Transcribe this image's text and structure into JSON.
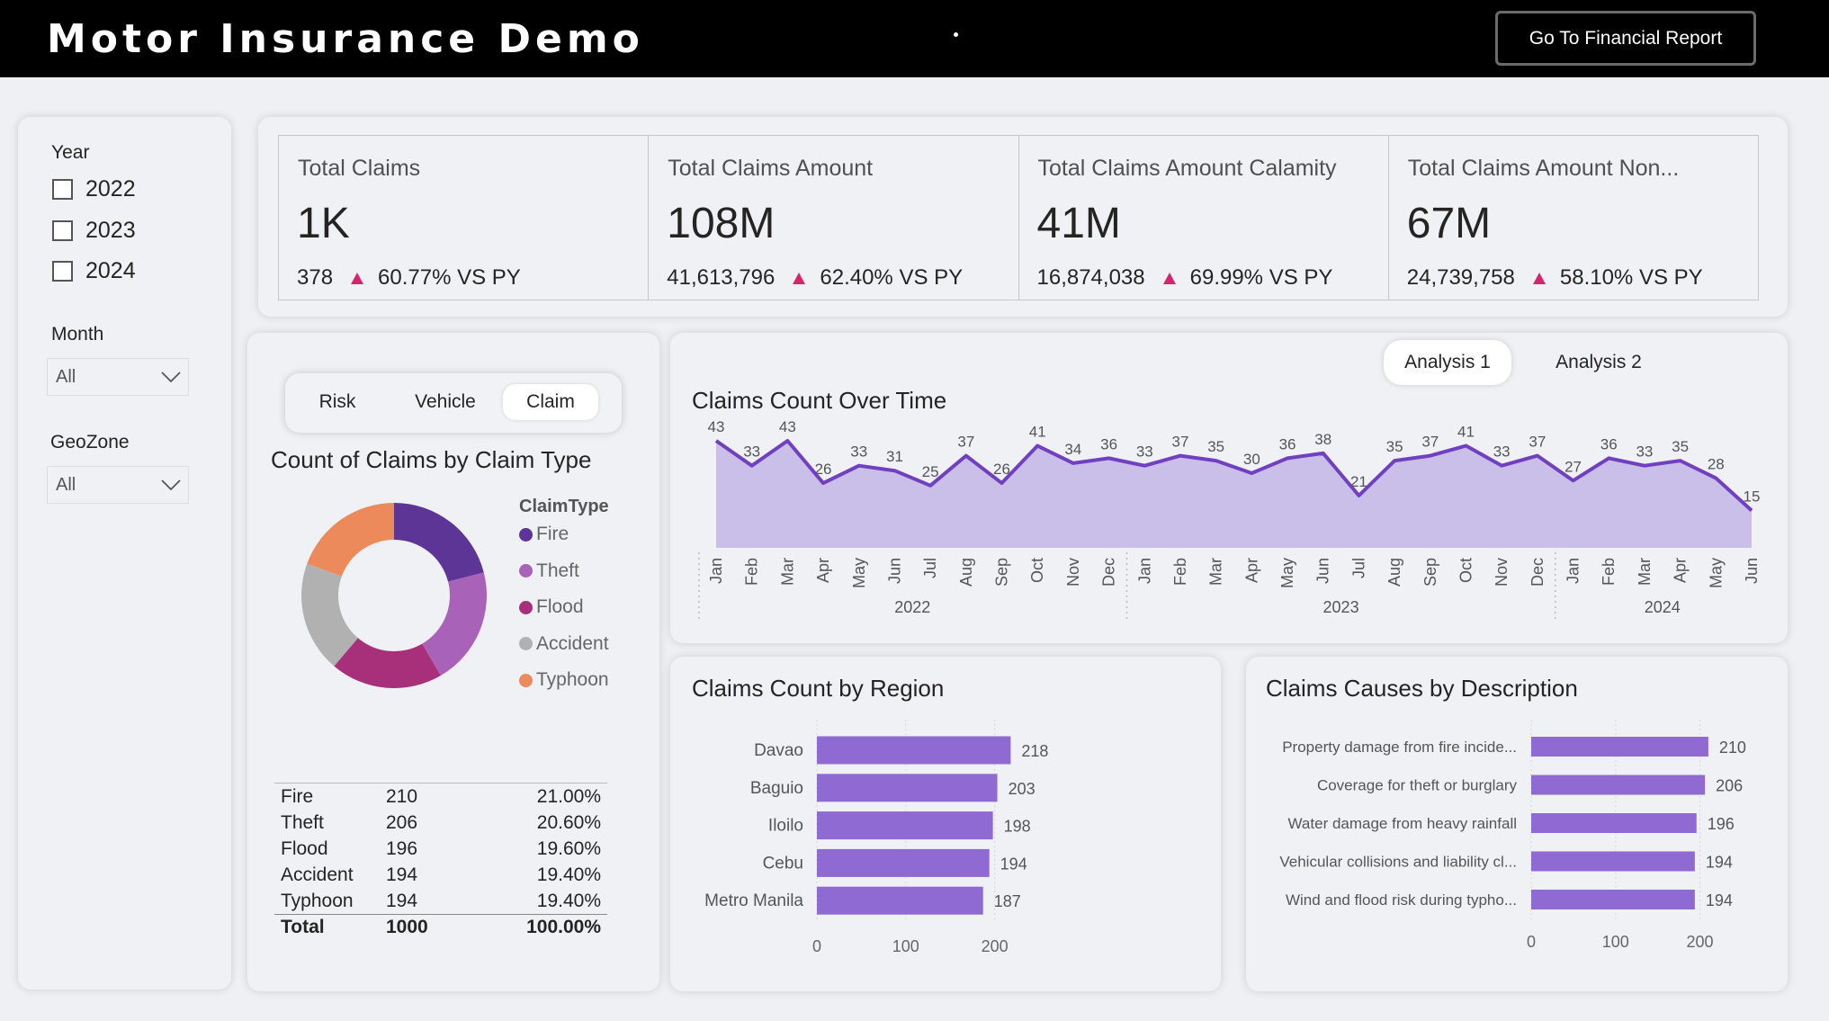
{
  "header": {
    "title": "Motor Insurance Demo",
    "financial_button": "Go To Financial Report"
  },
  "filters": {
    "year_label": "Year",
    "years": [
      "2022",
      "2023",
      "2024"
    ],
    "month_label": "Month",
    "month_value": "All",
    "geozone_label": "GeoZone",
    "geozone_value": "All"
  },
  "kpis": [
    {
      "title": "Total Claims",
      "value": "1K",
      "sub_value": "378",
      "change": "60.77% VS PY"
    },
    {
      "title": "Total Claims Amount",
      "value": "108M",
      "sub_value": "41,613,796",
      "change": "62.40% VS PY"
    },
    {
      "title": "Total Claims Amount Calamity",
      "value": "41M",
      "sub_value": "16,874,038",
      "change": "69.99% VS PY"
    },
    {
      "title": "Total Claims Amount Non...",
      "value": "67M",
      "sub_value": "24,739,758",
      "change": "58.10% VS PY"
    }
  ],
  "claim_type_panel": {
    "segments": [
      "Risk",
      "Vehicle",
      "Claim"
    ],
    "active_segment": "Claim",
    "title": "Count of Claims by Claim Type",
    "legend_title": "ClaimType",
    "table": {
      "rows": [
        {
          "type": "Fire",
          "count": "210",
          "pct": "21.00%"
        },
        {
          "type": "Theft",
          "count": "206",
          "pct": "20.60%"
        },
        {
          "type": "Flood",
          "count": "196",
          "pct": "19.60%"
        },
        {
          "type": "Accident",
          "count": "194",
          "pct": "19.40%"
        },
        {
          "type": "Typhoon",
          "count": "194",
          "pct": "19.40%"
        }
      ],
      "total": {
        "type": "Total",
        "count": "1000",
        "pct": "100.00%"
      }
    }
  },
  "analysis_tabs": {
    "tab1": "Analysis 1",
    "tab2": "Analysis 2",
    "active": "Analysis 1"
  },
  "colors": {
    "accent": "#7e57c2",
    "fire": "#5c3596",
    "theft": "#a862b8",
    "flood": "#a8307a",
    "accident": "#b1b1b1",
    "typhoon": "#ec8a5b",
    "line": "#7040c0",
    "area": "#c3b6e6",
    "bar": "#8e6ad2",
    "kpi_up": "#d6246e"
  },
  "chart_data": [
    {
      "type": "pie",
      "title": "Count of Claims by Claim Type",
      "legend_title": "ClaimType",
      "categories": [
        "Fire",
        "Theft",
        "Flood",
        "Accident",
        "Typhoon"
      ],
      "values": [
        210,
        206,
        196,
        194,
        194
      ]
    },
    {
      "type": "area",
      "title": "Claims Count Over Time",
      "x": [
        "Jan",
        "Feb",
        "Mar",
        "Apr",
        "May",
        "Jun",
        "Jul",
        "Aug",
        "Sep",
        "Oct",
        "Nov",
        "Dec",
        "Jan",
        "Feb",
        "Mar",
        "Apr",
        "May",
        "Jun",
        "Jul",
        "Aug",
        "Sep",
        "Oct",
        "Nov",
        "Dec",
        "Jan",
        "Feb",
        "Mar",
        "Apr",
        "May",
        "Jun"
      ],
      "years": [
        {
          "label": "2022",
          "months": 12
        },
        {
          "label": "2023",
          "months": 12
        },
        {
          "label": "2024",
          "months": 6
        }
      ],
      "values": [
        43,
        33,
        43,
        26,
        33,
        31,
        25,
        37,
        26,
        41,
        34,
        36,
        33,
        37,
        35,
        30,
        36,
        38,
        21,
        35,
        37,
        41,
        33,
        37,
        27,
        36,
        33,
        35,
        28,
        15
      ],
      "ylim": [
        0,
        43
      ]
    },
    {
      "type": "bar",
      "title": "Claims Count by Region",
      "categories": [
        "Davao",
        "Baguio",
        "Iloilo",
        "Cebu",
        "Metro Manila"
      ],
      "values": [
        218,
        203,
        198,
        194,
        187
      ],
      "xticks": [
        "0",
        "100",
        "200"
      ],
      "xlim": [
        0,
        250
      ]
    },
    {
      "type": "bar",
      "title": "Claims Causes by Description",
      "categories": [
        "Property damage from fire incide...",
        "Coverage for theft or burglary",
        "Water damage from heavy rainfall",
        "Vehicular collisions and liability cl...",
        "Wind and flood risk during typho..."
      ],
      "values": [
        210,
        206,
        196,
        194,
        194
      ],
      "xticks": [
        "0",
        "100",
        "200"
      ],
      "xlim": [
        0,
        240
      ]
    }
  ]
}
